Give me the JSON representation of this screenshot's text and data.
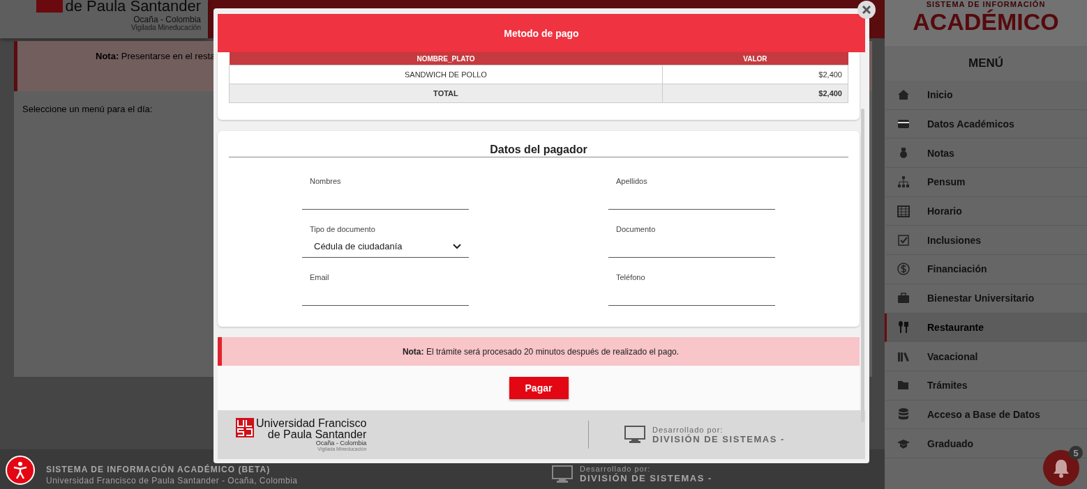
{
  "page": {
    "logo": {
      "name": "de Paula Santander",
      "city": "Ocaña - Colombia",
      "tagline": "Vigilada Mineducación"
    },
    "note": "**Nota:** Presentarse en el resta",
    "prompt": "Seleccione un menú para el día:",
    "footer": {
      "title": "SISTEMA DE INFORMACIÓN ACADÉMICO (BETA)",
      "subtitle": "Universidad Francisco de Paula Santander - Ocaña, Colombia",
      "developer_label": "Desarrollado por:",
      "developer": "DIVISIÓN DE SISTEMAS -"
    },
    "notifications": {
      "count": "5"
    }
  },
  "sidebar": {
    "system_label": "SISTEMA DE INFORMACIÓN",
    "title": "ACADÉMICO",
    "menu_title": "MENÚ",
    "items": [
      {
        "label": "Inicio",
        "selected": false
      },
      {
        "label": "Datos Académicos",
        "selected": false
      },
      {
        "label": "Notas",
        "selected": false
      },
      {
        "label": "Pensum",
        "selected": false
      },
      {
        "label": "Horario",
        "selected": false
      },
      {
        "label": "Inclusiones",
        "selected": false
      },
      {
        "label": "Financiación",
        "selected": false
      },
      {
        "label": "Bienestar Universitario",
        "selected": false
      },
      {
        "label": "Restaurante",
        "selected": true
      },
      {
        "label": "Vacacional",
        "selected": false
      },
      {
        "label": "Trámites",
        "selected": false
      },
      {
        "label": "Acceso a Base de Datos",
        "selected": false
      },
      {
        "label": "Graduado",
        "selected": false
      }
    ]
  },
  "modal": {
    "title": "Metodo de pago",
    "table": {
      "columns": [
        "NOMBRE_PLATO",
        "VALOR"
      ],
      "rows": [
        [
          "SANDWICH DE POLLO",
          "$2,400"
        ]
      ],
      "total": [
        "TOTAL",
        "$2,400"
      ]
    },
    "section_title": "Datos del pagador",
    "fields": [
      {
        "label": "Nombres",
        "kind": "text"
      },
      {
        "label": "Apellidos",
        "kind": "text"
      },
      {
        "label": "Tipo de documento",
        "kind": "select",
        "value": "Cédula de ciudadanía"
      },
      {
        "label": "Documento",
        "kind": "text"
      },
      {
        "label": "Email",
        "kind": "text"
      },
      {
        "label": "Teléfono",
        "kind": "text"
      }
    ],
    "note": "**Nota:** El trámite será procesado 20 minutos después de realizado el pago.",
    "button": "Pagar",
    "footer": {
      "logo": [
        "Universidad Francisco",
        "de Paula Santander",
        "Ocaña - Colombia",
        "Vigilada Mineducación"
      ],
      "developer_label": "Desarrollado por:",
      "developer": "DIVISIÓN DE SISTEMAS -"
    }
  }
}
